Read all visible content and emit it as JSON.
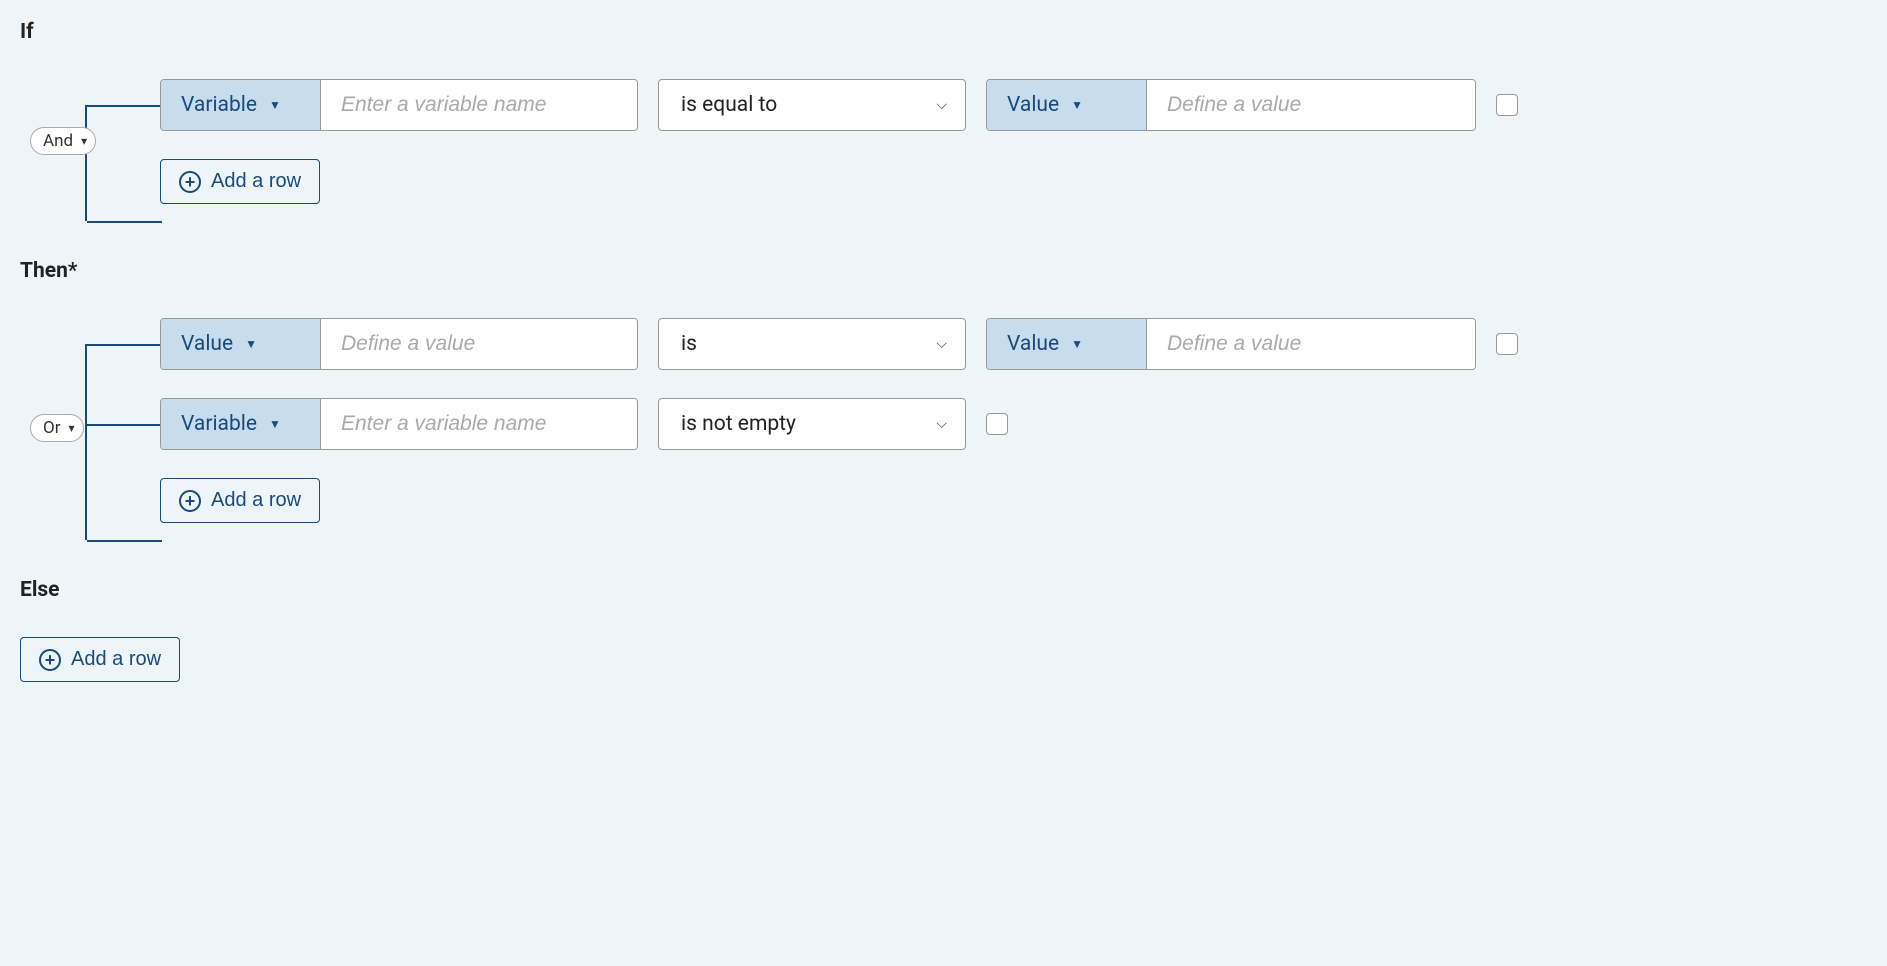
{
  "sections": {
    "if": {
      "label": "If",
      "connector": "And",
      "rows": [
        {
          "left_type": "Variable",
          "left_placeholder": "Enter a variable name",
          "operator": "is equal to",
          "has_right": true,
          "right_type": "Value",
          "right_placeholder": "Define a value"
        }
      ],
      "add_label": "Add a row"
    },
    "then": {
      "label": "Then*",
      "connector": "Or",
      "rows": [
        {
          "left_type": "Value",
          "left_placeholder": "Define a value",
          "operator": "is",
          "has_right": true,
          "right_type": "Value",
          "right_placeholder": "Define a value"
        },
        {
          "left_type": "Variable",
          "left_placeholder": "Enter a variable name",
          "operator": "is not empty",
          "has_right": false
        }
      ],
      "add_label": "Add a row"
    },
    "else": {
      "label": "Else",
      "add_label": "Add a row"
    }
  }
}
